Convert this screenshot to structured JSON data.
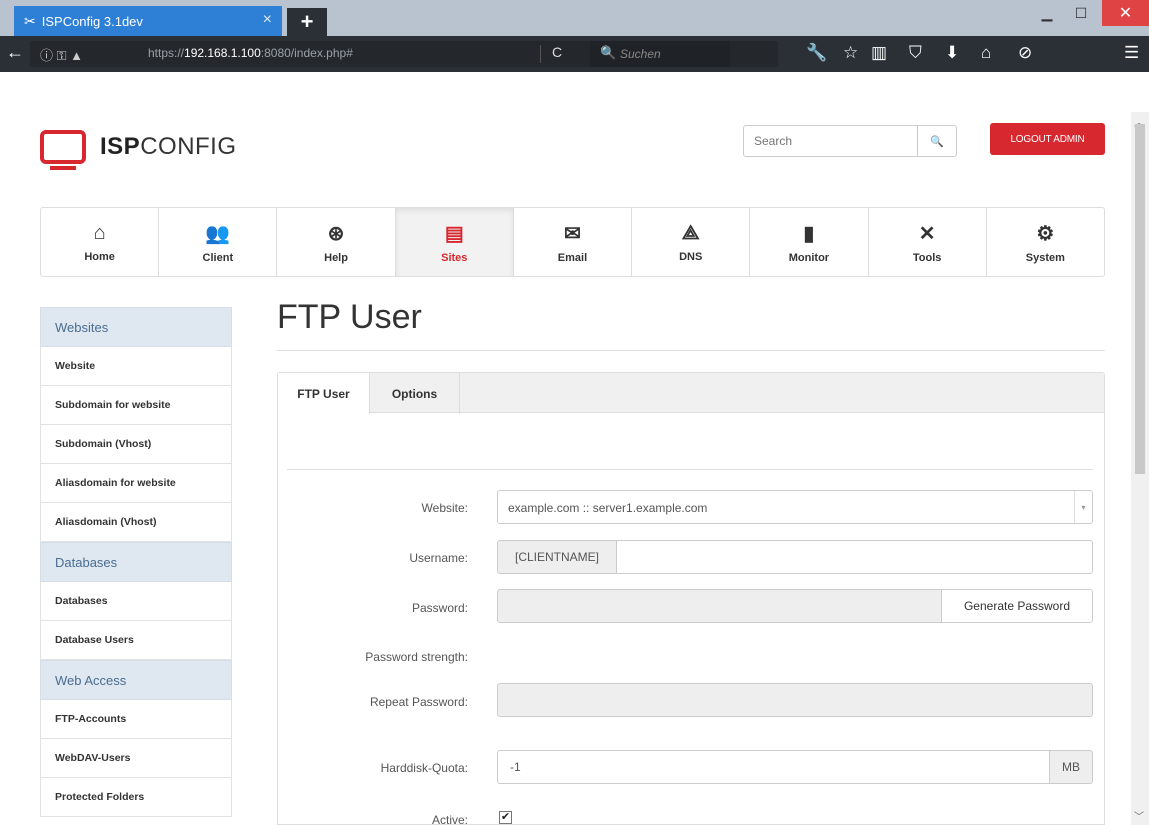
{
  "browser": {
    "tab_title": "ISPConfig 3.1dev",
    "tab_close": "×",
    "new_tab": "+",
    "url_prefix": "https://",
    "url_host": "192.168.1.100",
    "url_rest": ":8080/index.php#",
    "search_placeholder": "Suchen"
  },
  "header": {
    "logo_bold": "ISP",
    "logo_light": "CONFIG",
    "search_placeholder": "Search",
    "logout_label": "LOGOUT ADMIN"
  },
  "topnav": [
    {
      "label": "Home",
      "icon": "home-icon",
      "glyph": "⌂"
    },
    {
      "label": "Client",
      "icon": "users-icon",
      "glyph": "👥"
    },
    {
      "label": "Help",
      "icon": "lifebuoy-icon",
      "glyph": "⊛"
    },
    {
      "label": "Sites",
      "icon": "browser-window-icon",
      "glyph": "▤",
      "active": true
    },
    {
      "label": "Email",
      "icon": "envelope-icon",
      "glyph": "✉"
    },
    {
      "label": "DNS",
      "icon": "network-icon",
      "glyph": "⟁"
    },
    {
      "label": "Monitor",
      "icon": "traffic-light-icon",
      "glyph": "▮"
    },
    {
      "label": "Tools",
      "icon": "tools-icon",
      "glyph": "✕"
    },
    {
      "label": "System",
      "icon": "gear-icon",
      "glyph": "⚙"
    }
  ],
  "sidebar": {
    "sections": [
      {
        "title": "Websites",
        "items": [
          "Website",
          "Subdomain for website",
          "Subdomain (Vhost)",
          "Aliasdomain for website",
          "Aliasdomain (Vhost)"
        ]
      },
      {
        "title": "Databases",
        "items": [
          "Databases",
          "Database Users"
        ]
      },
      {
        "title": "Web Access",
        "items": [
          "FTP-Accounts",
          "WebDAV-Users",
          "Protected Folders"
        ]
      }
    ]
  },
  "main": {
    "title": "FTP User",
    "tabs": [
      "FTP User",
      "Options"
    ],
    "form": {
      "website_label": "Website:",
      "website_value": "example.com :: server1.example.com",
      "username_label": "Username:",
      "username_prefix": "[CLIENTNAME]",
      "username_value": "",
      "password_label": "Password:",
      "generate_password": "Generate Password",
      "strength_label": "Password strength:",
      "repeat_label": "Repeat Password:",
      "quota_label": "Harddisk-Quota:",
      "quota_value": "-1",
      "quota_unit": "MB",
      "active_label": "Active:",
      "active_checked": true
    }
  }
}
